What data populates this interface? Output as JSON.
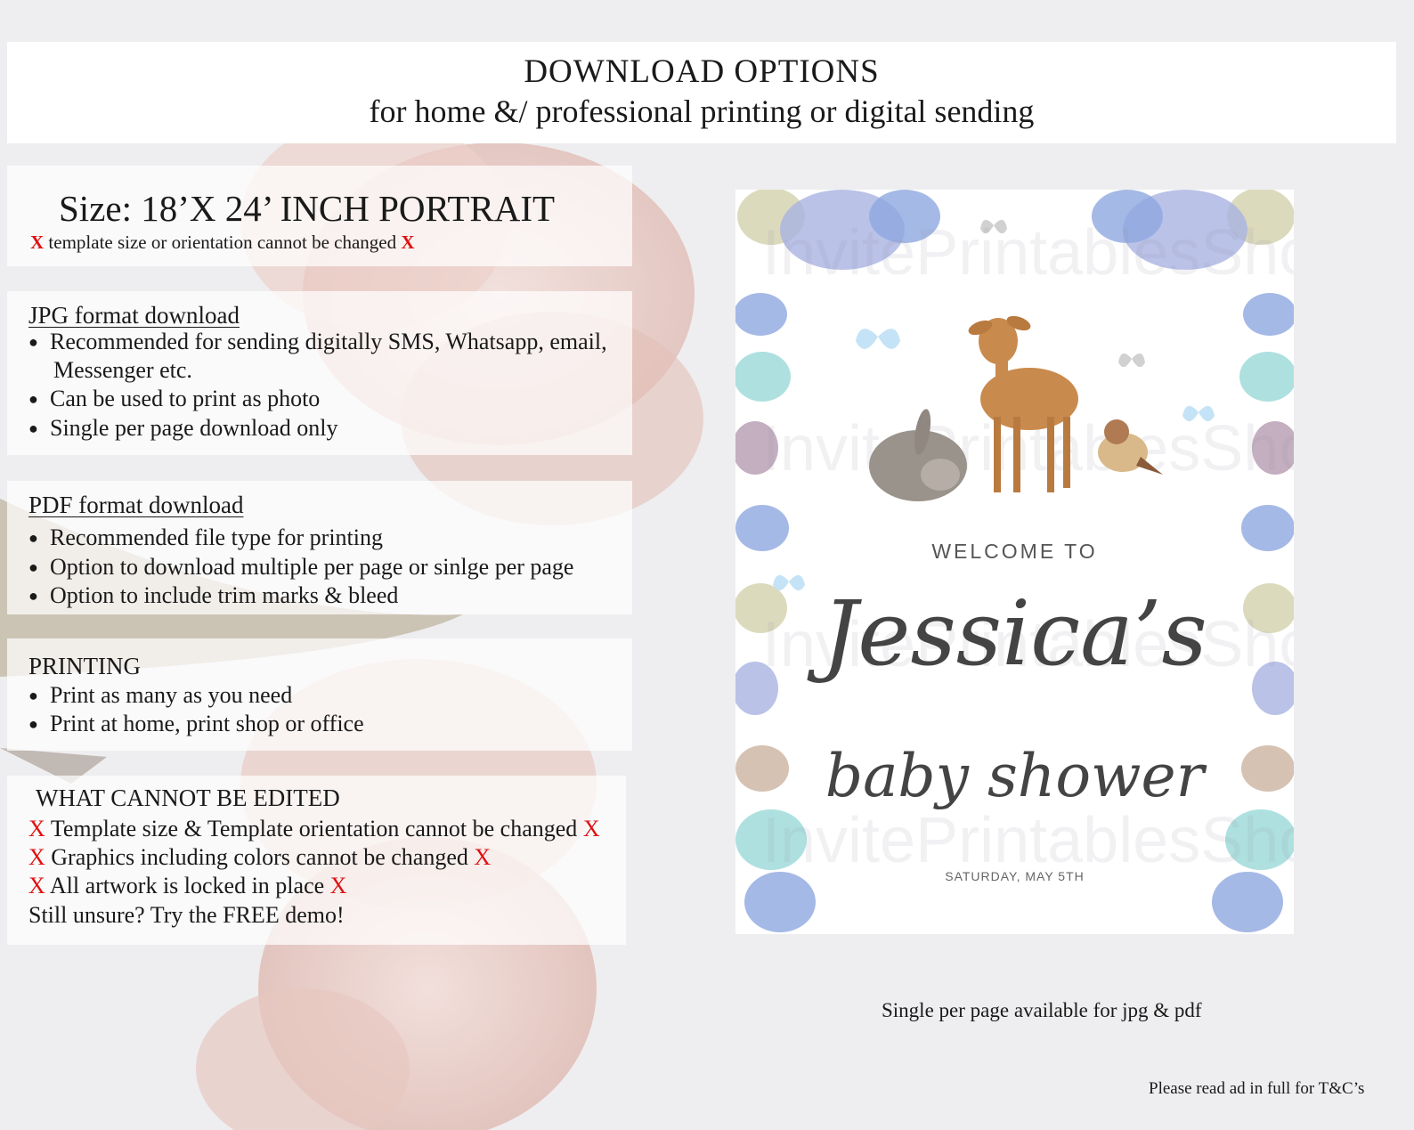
{
  "header": {
    "title": "DOWNLOAD OPTIONS",
    "subtitle": "for home &/ professional printing or digital sending"
  },
  "size_panel": {
    "title": "Size: 18’X 24’ INCH PORTRAIT",
    "x_mark": "X",
    "note": "template size or orientation cannot be changed"
  },
  "jpg_panel": {
    "heading": "JPG format download",
    "items": [
      "Recommended for sending digitally SMS, Whatsapp, email,",
      "Messenger etc.",
      "Can be used to print as photo",
      "Single per page download only"
    ]
  },
  "pdf_panel": {
    "heading": "PDF format download",
    "items": [
      "Recommended file type for printing",
      "Option to download multiple per page or sinlge per page",
      "Option to include trim marks & bleed"
    ]
  },
  "printing_panel": {
    "heading": "PRINTING",
    "items": [
      "Print as many as you need",
      "Print at home, print shop or office"
    ]
  },
  "edit_panel": {
    "heading": "WHAT CANNOT BE EDITED",
    "x_mark": "X",
    "items": [
      "Template size & Template orientation cannot be changed",
      "Graphics including colors cannot be changed",
      "All artwork is locked in place"
    ],
    "demo_text": "Still unsure? Try the FREE demo!"
  },
  "poster": {
    "welcome": "WELCOME TO",
    "name": "Jessica’s",
    "event": "baby shower",
    "date": "SATURDAY, MAY 5TH",
    "watermark": "InvitePrintablesShop"
  },
  "caption": "Single per page available for jpg & pdf",
  "footer": "Please read ad in full for T&C’s",
  "colors": {
    "x_mark": "#e01010",
    "petal": "#e8c9c4",
    "floral_blue": "#8fa8e0",
    "floral_aqua": "#9ad8d8",
    "floral_mauve": "#9c7a96",
    "deer": "#c98a4d"
  },
  "icons": [
    "bullet-icon",
    "x-mark-icon",
    "deer-illustration",
    "bunny-illustration",
    "bird-illustration",
    "butterfly-icon",
    "floral-border"
  ]
}
